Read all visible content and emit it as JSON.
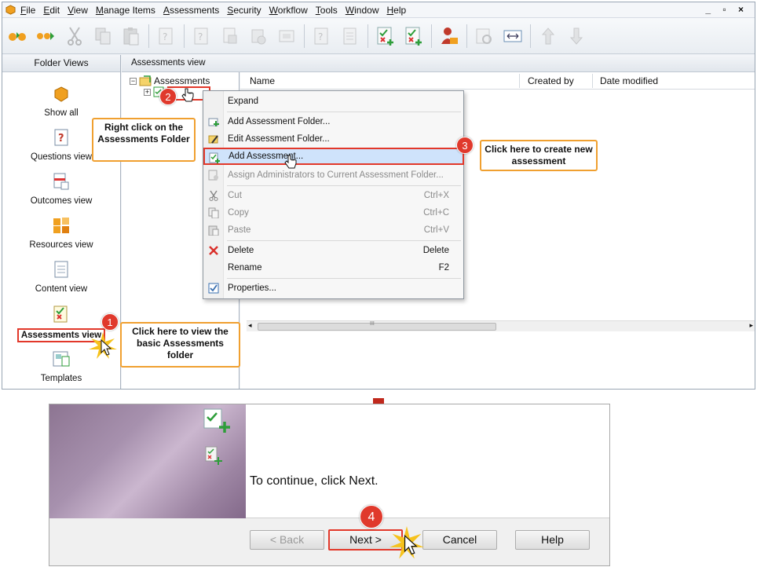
{
  "menubar": {
    "items": [
      "File",
      "Edit",
      "View",
      "Manage Items",
      "Assessments",
      "Security",
      "Workflow",
      "Tools",
      "Window",
      "Help"
    ],
    "window_controls": "_ ▫ ×"
  },
  "folder_views": {
    "header": "Folder Views",
    "items": [
      {
        "label": "Show all",
        "icon": "show-all-icon"
      },
      {
        "label": "Questions view",
        "icon": "questions-icon"
      },
      {
        "label": "Outcomes view",
        "icon": "outcomes-icon"
      },
      {
        "label": "Resources view",
        "icon": "resources-icon"
      },
      {
        "label": "Content view",
        "icon": "content-icon"
      },
      {
        "label": "Assessments view",
        "icon": "assessments-icon",
        "selected": true
      },
      {
        "label": "Templates",
        "icon": "templates-icon"
      }
    ]
  },
  "pane": {
    "header": "Assessments view",
    "tree_root": "Assessments"
  },
  "list": {
    "columns": [
      "Name",
      "Created by",
      "Date modified"
    ],
    "scroll_mark": "III"
  },
  "context_menu": {
    "items": [
      {
        "label": "Expand",
        "shortcut": ""
      },
      {
        "label": "Add Assessment Folder...",
        "shortcut": ""
      },
      {
        "label": "Edit Assessment Folder...",
        "shortcut": ""
      },
      {
        "label": "Add Assessment...",
        "shortcut": "",
        "highlighted": true
      },
      {
        "label": "Assign Administrators to Current Assessment Folder...",
        "shortcut": "",
        "disabled": true
      },
      {
        "label": "Cut",
        "shortcut": "Ctrl+X",
        "disabled": true
      },
      {
        "label": "Copy",
        "shortcut": "Ctrl+C",
        "disabled": true
      },
      {
        "label": "Paste",
        "shortcut": "Ctrl+V",
        "disabled": true
      },
      {
        "label": "Delete",
        "shortcut": "Delete"
      },
      {
        "label": "Rename",
        "shortcut": "F2"
      },
      {
        "label": "Properties...",
        "shortcut": ""
      }
    ]
  },
  "callouts": {
    "step1": "Click here to view the basic Assessments folder",
    "step2": "Right click on the Assessments Folder",
    "step3": "Click here to create new assessment"
  },
  "badges": [
    "1",
    "2",
    "3",
    "4"
  ],
  "wizard": {
    "message": "To continue, click Next.",
    "buttons": {
      "back": "< Back",
      "next": "Next >",
      "cancel": "Cancel",
      "help": "Help"
    }
  },
  "colors": {
    "highlight_red": "#e2382a",
    "callout_border": "#f0a030",
    "menu_highlight": "#cfe3fb"
  }
}
